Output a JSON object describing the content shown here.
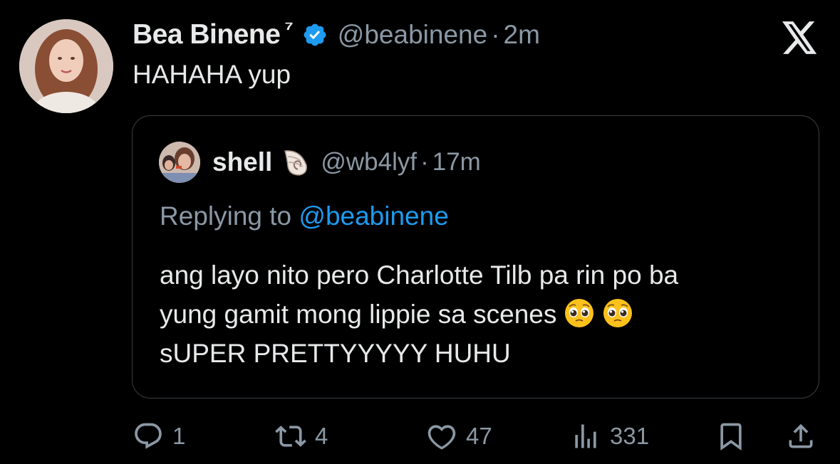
{
  "tweet": {
    "display_name": "Bea Binene",
    "name_suffix": "⁷",
    "handle": "@beabinene",
    "separator": "·",
    "time": "2m",
    "text": "HAHAHA yup",
    "avatar_icon": "profile-photo",
    "verified_icon": "verified-badge-icon",
    "brand_icon": "x-logo-icon"
  },
  "quoted": {
    "display_name": "shell",
    "name_emoji_icon": "spiral-shell-emoji",
    "handle": "@wb4lyf",
    "separator": "·",
    "time": "17m",
    "replying_prefix": "Replying to",
    "replying_handle": "@beabinene",
    "line1": "ang layo nito pero Charlotte Tilb pa rin po ba",
    "line2": "yung gamit mong lippie sa scenes",
    "line3": "sUPER PRETTYYYYY HUHU",
    "emoji_icon": "pleading-face-emoji"
  },
  "actions": {
    "replies": "1",
    "reposts": "4",
    "likes": "47",
    "views": "331"
  },
  "colors": {
    "background": "#000000",
    "text": "#e7e9ea",
    "muted": "#8b98a5",
    "accent": "#1d9bf0",
    "border": "#3a3f44"
  }
}
